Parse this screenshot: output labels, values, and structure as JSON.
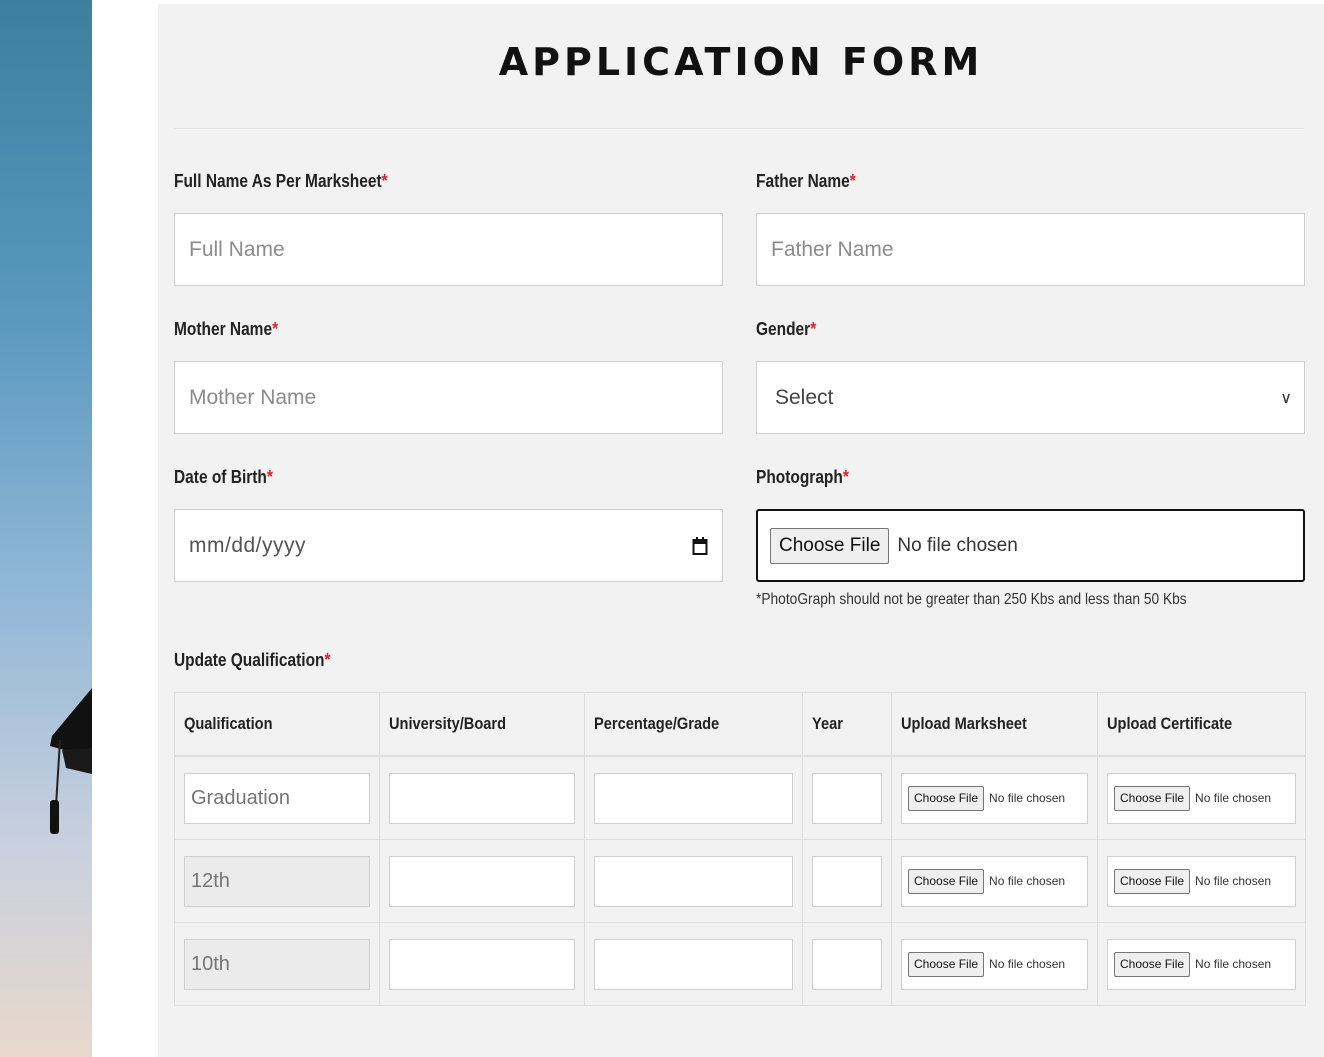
{
  "form": {
    "title": "APPLICATION FORM",
    "full_name": {
      "label": "Full Name As Per Marksheet",
      "required_mark": "*",
      "placeholder": "Full Name"
    },
    "father_name": {
      "label": "Father Name",
      "required_mark": "*",
      "placeholder": "Father Name"
    },
    "mother_name": {
      "label": "Mother Name",
      "required_mark": "*",
      "placeholder": "Mother Name"
    },
    "gender": {
      "label": "Gender",
      "required_mark": "*",
      "selected": "Select",
      "chevron": "∨"
    },
    "dob": {
      "label": "Date of Birth",
      "required_mark": "*",
      "placeholder": "mm/dd/yyyy"
    },
    "photograph": {
      "label": "Photograph",
      "required_mark": "*",
      "button": "Choose File",
      "status": "No file chosen",
      "hint": "*PhotoGraph should not be greater than 250 Kbs and less than 50 Kbs"
    },
    "qualification": {
      "label": "Update Qualification",
      "required_mark": "*",
      "headers": [
        "Qualification",
        "University/Board",
        "Percentage/Grade",
        "Year",
        "Upload Marksheet",
        "Upload Certificate"
      ],
      "rows": [
        {
          "qualification_placeholder": "Graduation",
          "readonly": false,
          "marksheet_button": "Choose File",
          "marksheet_status": "No file chosen",
          "certificate_button": "Choose File",
          "certificate_status": "No file chosen"
        },
        {
          "qualification_placeholder": "12th",
          "readonly": true,
          "marksheet_button": "Choose File",
          "marksheet_status": "No file chosen",
          "certificate_button": "Choose File",
          "certificate_status": "No file chosen"
        },
        {
          "qualification_placeholder": "10th",
          "readonly": true,
          "marksheet_button": "Choose File",
          "marksheet_status": "No file chosen",
          "certificate_button": "Choose File",
          "certificate_status": "No file chosen"
        }
      ]
    }
  },
  "colors": {
    "required": "#e0222a",
    "panel_bg": "#f2f2f2"
  }
}
